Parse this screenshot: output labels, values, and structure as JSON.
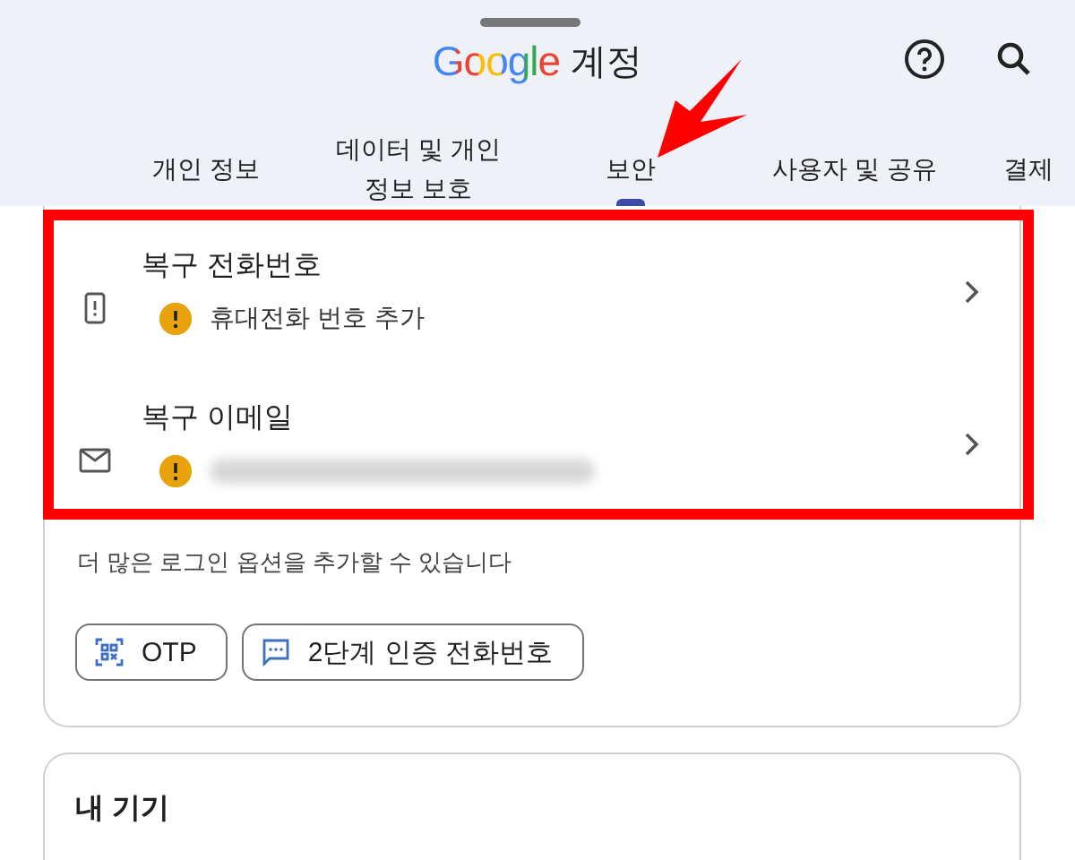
{
  "header": {
    "logo": "Google",
    "title": "계정",
    "tabs": [
      {
        "label": "개인 정보",
        "selected": false
      },
      {
        "label": "데이터 및 개인 정보 보호",
        "selected": false
      },
      {
        "label": "보안",
        "selected": true
      },
      {
        "label": "사용자 및 공유",
        "selected": false
      },
      {
        "label": "결제",
        "selected": false
      }
    ]
  },
  "recovery": {
    "items": [
      {
        "kind": "phone",
        "title": "복구 전화번호",
        "status": "휴대전화 번호 추가"
      },
      {
        "kind": "email",
        "title": "복구 이메일",
        "redacted": true
      }
    ],
    "hint": "더 많은 로그인 옵션을 추가할 수 있습니다",
    "options": [
      {
        "kind": "otp",
        "label": "OTP"
      },
      {
        "kind": "sms",
        "label": "2단계 인증 전화번호"
      }
    ]
  },
  "devices": {
    "title": "내 기기"
  },
  "annotation": {
    "highlight": true,
    "arrow": true
  }
}
